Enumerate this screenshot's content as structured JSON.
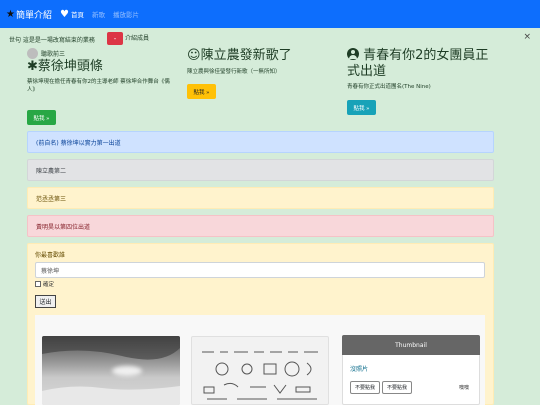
{
  "navbar": {
    "brand": "簡單介紹",
    "links": [
      {
        "label": "首頁",
        "active": true
      },
      {
        "label": "新歌",
        "active": false
      },
      {
        "label": "播放影片",
        "active": false
      }
    ]
  },
  "alert": {
    "text": "世句 這是是一場改寫結束的業務",
    "red_button": "-",
    "text2": "介紹成員",
    "close": "×"
  },
  "columns": [
    {
      "icon": "avatar-icon",
      "caption": "聽歌前三",
      "title": "蔡徐坤頭條",
      "title_icon": "✱",
      "body": "蔡徐坤現在擔任青春有你2的主導老師 蔡徐坤合作舞台《偶人》",
      "button": "點我 »"
    },
    {
      "icon": "smile-icon",
      "caption": "",
      "title": "陳立農發新歌了",
      "title_icon": "☺",
      "body": "陳立農與徐佳瑩發行新歌（一無所知）",
      "button": "點我 »"
    },
    {
      "icon": "user-circle-icon",
      "caption": "",
      "title": "青春有你2的女團員正式出道",
      "title_icon": "",
      "body": "青春有你正式出道團名(The Nine)",
      "button": "點我 »"
    }
  ],
  "panels": [
    "(前自名) 蔡徐坤以實力第一出道",
    "陳立農第二",
    "范丞丞第三",
    "黃明昊以第四位出道"
  ],
  "form": {
    "label": "你最喜歡誰",
    "input_value": "蔡徐坤",
    "checkbox_label": "確定",
    "submit": "送出"
  },
  "gallery": {
    "thumbnail_header": "Thumbnail",
    "card_text": "沒照片",
    "btn1": "不要點我",
    "btn2": "不要點我",
    "right_text": "噢噢"
  },
  "colors": {
    "navbar": "#0d6efd",
    "background": "#d5ecd9",
    "green_button": "#28a745",
    "yellow_button": "#ffc107",
    "cyan_button": "#17a2b8",
    "red_button": "#dc3545"
  }
}
